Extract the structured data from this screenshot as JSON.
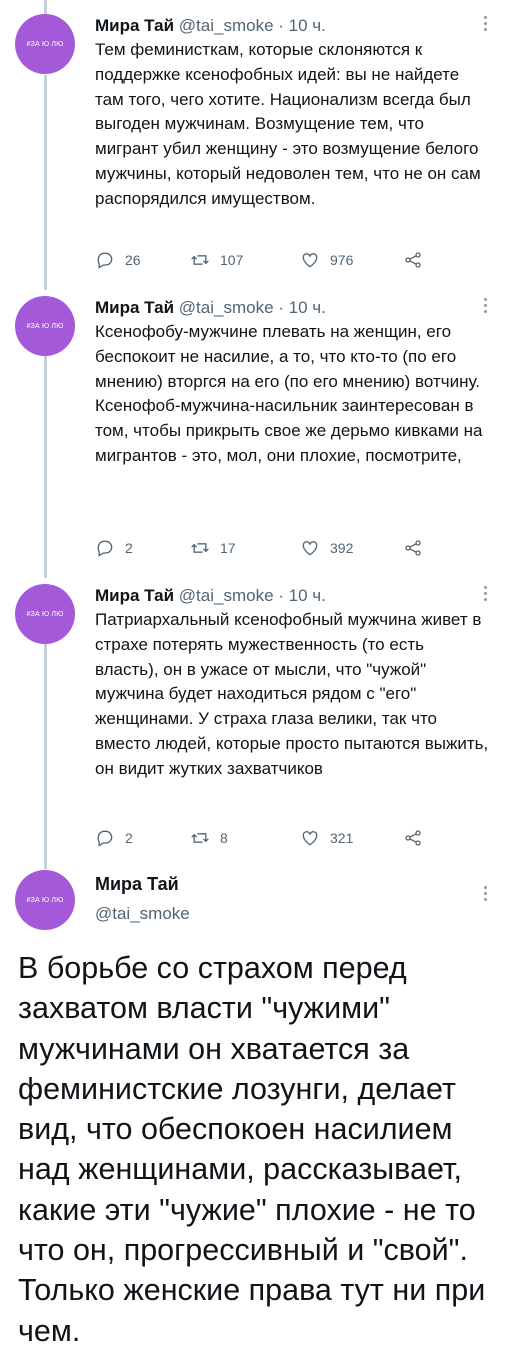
{
  "tweets": [
    {
      "avatar_text": "#ЗА Ю ЛЮ",
      "name": "Мира Тай",
      "meta": "@tai_smoke · 10 ч.",
      "text": "Тем феминисткам, которые склоняются к поддержке ксенофобных идей: вы не найдете там того, чего хотите. Национализм всегда был выгоден мужчинам. Возмущение тем, что мигрант убил женщину - это возмущение белого мужчины, который недоволен тем, что не он сам распорядился имуществом.",
      "replies": "26",
      "retweets": "107",
      "likes": "976"
    },
    {
      "avatar_text": "#ЗА Ю ЛЮ",
      "name": "Мира Тай",
      "meta": "@tai_smoke · 10 ч.",
      "text": "Ксенофобу-мужчине плевать на женщин, его беспокоит не насилие, а то, что кто-то (по его мнению) вторгся на его (по его мнению) вотчину.\nКсенофоб-мужчина-насильник заинтересован в том, чтобы прикрыть свое же дерьмо кивками на мигрантов - это, мол, они плохие, посмотрите,",
      "replies": "2",
      "retweets": "17",
      "likes": "392"
    },
    {
      "avatar_text": "#ЗА Ю ЛЮ",
      "name": "Мира Тай",
      "meta": "@tai_smoke · 10 ч.",
      "text": "Патриархальный ксенофобный мужчина живет в страхе потерять мужественность (то есть власть), он в ужасе от мысли, что \"чужой\" мужчина будет находиться рядом с \"его\" женщинами. У страха глаза велики, так что вместо людей, которые просто пытаются выжить, он видит жутких захватчиков",
      "replies": "2",
      "retweets": "8",
      "likes": "321"
    }
  ],
  "main_tweet": {
    "avatar_text": "#ЗА Ю ЛЮ",
    "name": "Мира Тай",
    "handle": "@tai_smoke",
    "text": "В борьбе со страхом перед захватом власти \"чужими\" мужчинами он хватается за феминистские лозунги, делает вид, что обеспокоен насилием над женщинами, рассказывает, какие эти \"чужие\" плохие - не то что он, прогрессивный и \"свой\". Только женские права тут ни при чем."
  }
}
